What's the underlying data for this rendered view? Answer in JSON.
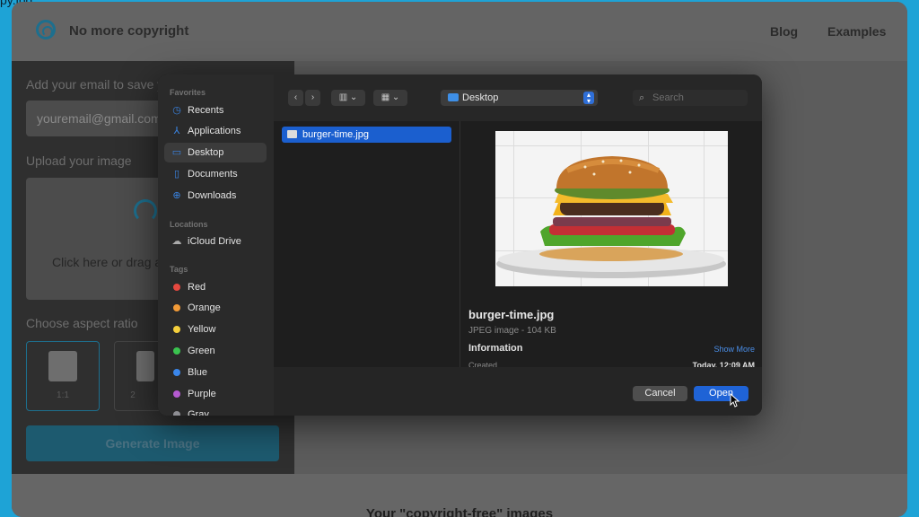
{
  "background_page": {
    "title_fragment": "py.jpg",
    "brand": "No more copyright",
    "nav": [
      "Blog",
      "Examples"
    ],
    "email_label": "Add your email to save y",
    "email_value": "youremail@gmail.com",
    "upload_label": "Upload your image",
    "upload_text": "Click here or drag a",
    "aspect_label": "Choose aspect ratio",
    "ratios": [
      "1:1",
      "2"
    ],
    "generate_label": "Generate Image",
    "gallery_heading": "Your \"copyright-free\" images"
  },
  "dialog": {
    "sidebar": {
      "favorites_header": "Favorites",
      "favorites": [
        {
          "label": "Recents",
          "icon": "clock-icon"
        },
        {
          "label": "Applications",
          "icon": "applications-icon"
        },
        {
          "label": "Desktop",
          "icon": "desktop-icon"
        },
        {
          "label": "Documents",
          "icon": "document-icon"
        },
        {
          "label": "Downloads",
          "icon": "download-icon"
        }
      ],
      "locations_header": "Locations",
      "locations": [
        {
          "label": "iCloud Drive",
          "icon": "cloud-icon"
        }
      ],
      "tags_header": "Tags",
      "tags": [
        {
          "label": "Red",
          "color": "#e5483f"
        },
        {
          "label": "Orange",
          "color": "#f19a37"
        },
        {
          "label": "Yellow",
          "color": "#f4cf3c"
        },
        {
          "label": "Green",
          "color": "#3ac34f"
        },
        {
          "label": "Blue",
          "color": "#3a86ea"
        },
        {
          "label": "Purple",
          "color": "#b45ad0"
        },
        {
          "label": "Gray",
          "color": "#8e8e93"
        }
      ],
      "selected": "Desktop"
    },
    "toolbar": {
      "location": "Desktop",
      "search_placeholder": "Search"
    },
    "files": [
      "burger-time.jpg"
    ],
    "preview": {
      "name": "burger-time.jpg",
      "kind": "JPEG image - 104 KB",
      "information": "Information",
      "show_more": "Show More",
      "created_label": "Created",
      "created_value": "Today, 12:09 AM"
    },
    "buttons": {
      "cancel": "Cancel",
      "open": "Open"
    }
  },
  "colors": {
    "accent": "#1f63d6",
    "outer_background": "#1ea3d6"
  }
}
